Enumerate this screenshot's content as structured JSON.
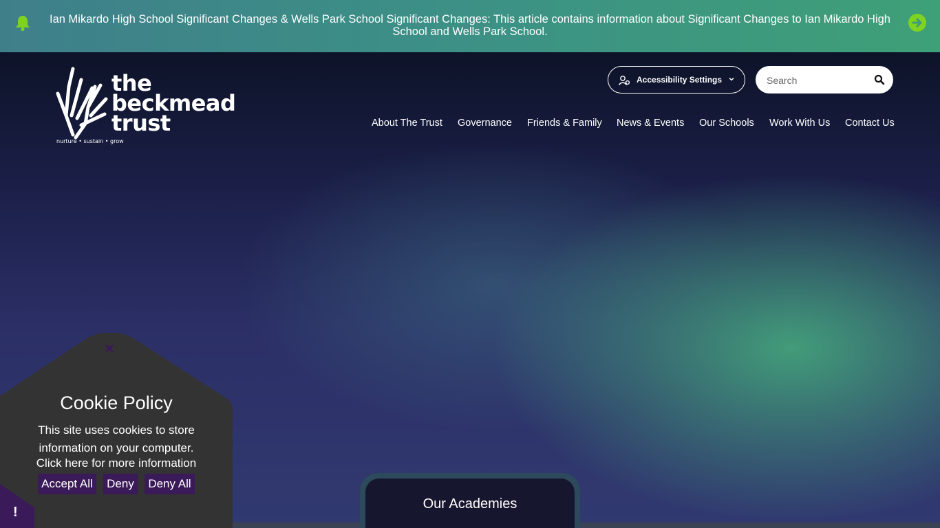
{
  "alert": {
    "text": "Ian Mikardo High School Significant Changes & Wells Park School Significant Changes: This article contains information about Significant Changes to Ian Mikardo High School and Wells Park School.",
    "icon": "bell-icon",
    "action_icon": "arrow-right-icon",
    "accent": "#7ed321"
  },
  "header": {
    "logo": {
      "lines": [
        "the",
        "beckmead",
        "trust"
      ],
      "tagline": "nurture • sustain • grow"
    },
    "accessibility_label": "Accessibility Settings",
    "search_placeholder": "Search"
  },
  "nav": {
    "items": [
      {
        "label": "About The Trust"
      },
      {
        "label": "Governance"
      },
      {
        "label": "Friends & Family"
      },
      {
        "label": "News & Events"
      },
      {
        "label": "Our Schools"
      },
      {
        "label": "Work With Us"
      },
      {
        "label": "Contact Us"
      }
    ]
  },
  "academies": {
    "title": "Our Academies"
  },
  "cookie": {
    "title": "Cookie Policy",
    "body": "This site uses cookies to store information on your computer.",
    "link": "Click here for more information",
    "buttons": {
      "accept_all": "Accept All",
      "deny": "Deny",
      "deny_all": "Deny All"
    },
    "tab_mark": "!",
    "colors": {
      "panel": "#333333",
      "button": "#3a1a58",
      "tab": "#3a1a58"
    }
  }
}
